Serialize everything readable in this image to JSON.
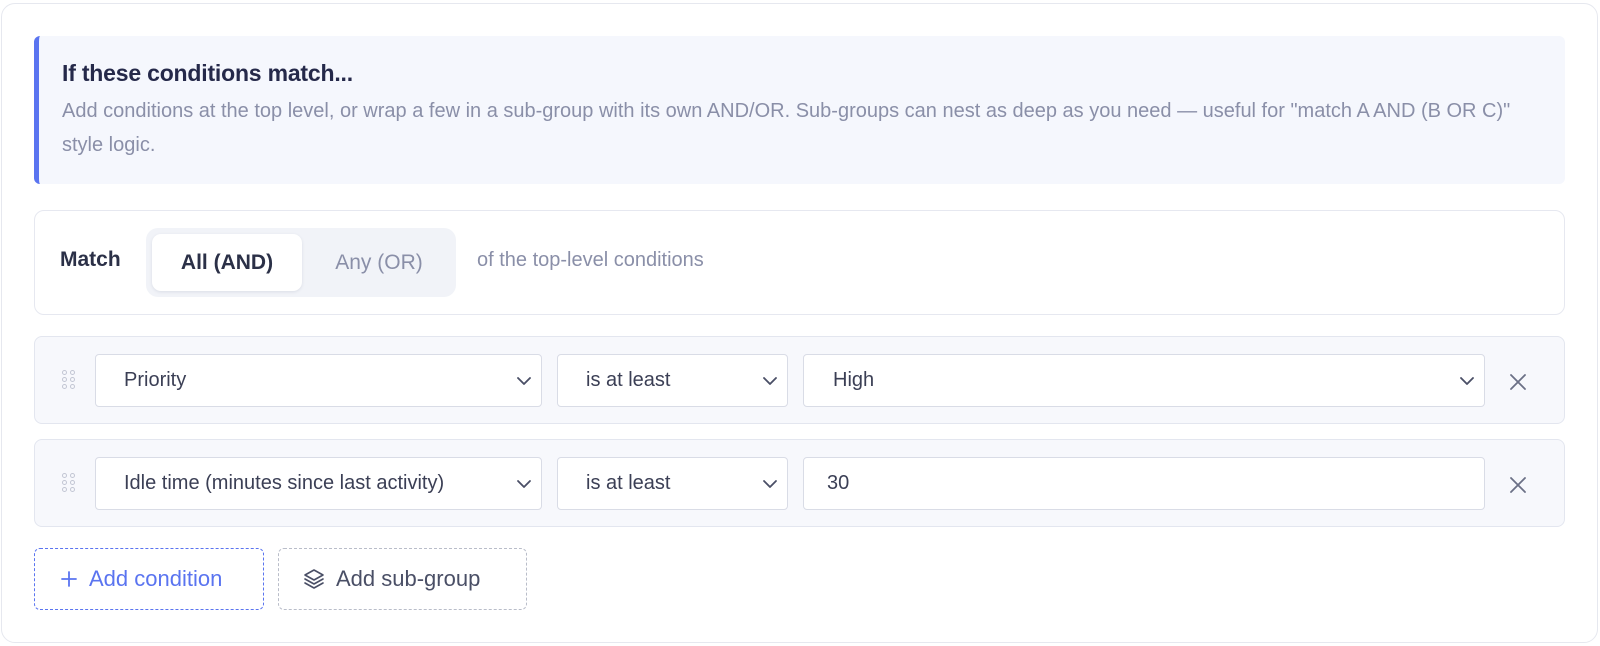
{
  "info": {
    "title": "If these conditions match...",
    "text": "Add conditions at the top level, or wrap a few in a sub-group with its own AND/OR. Sub-groups can nest as deep as you need — useful for \"match A AND (B OR C)\" style logic."
  },
  "match": {
    "label": "Match",
    "options": [
      "All (AND)",
      "Any (OR)"
    ],
    "selected": "All (AND)",
    "suffix": "of the top-level conditions"
  },
  "conditions": [
    {
      "field": "Priority",
      "operator": "is at least",
      "value": "High",
      "value_type": "select"
    },
    {
      "field": "Idle time (minutes since last activity)",
      "operator": "is at least",
      "value": "30",
      "value_type": "input"
    }
  ],
  "actions": {
    "add_condition": "Add condition",
    "add_subgroup": "Add sub-group"
  },
  "colors": {
    "accent": "#5a74f0",
    "muted_text": "#8a8fa8",
    "heading": "#25294a"
  },
  "icons": [
    "drag-handle-icon",
    "chevron-down-icon",
    "close-icon",
    "plus-icon",
    "layers-icon"
  ]
}
